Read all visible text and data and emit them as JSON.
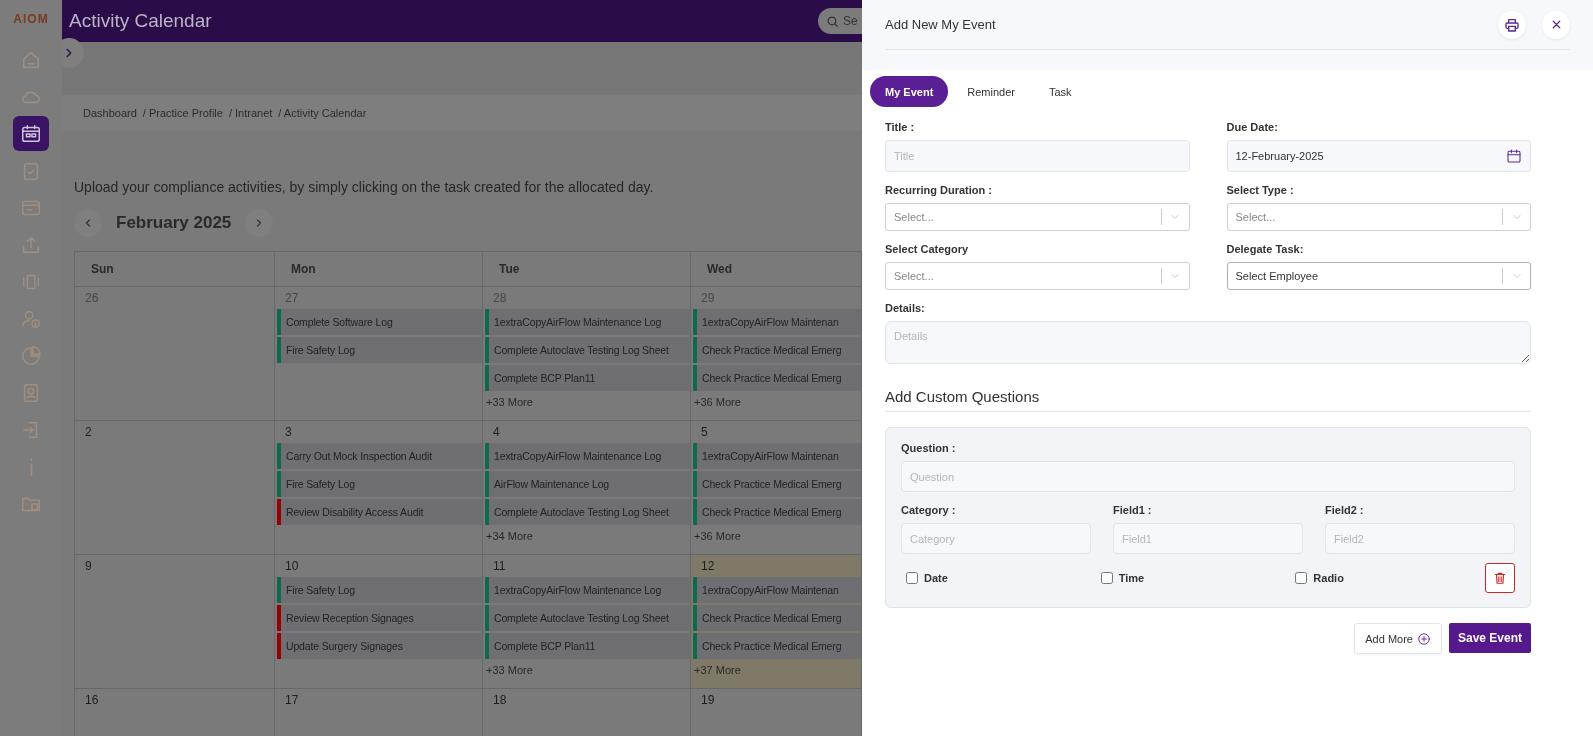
{
  "logo": "AIOM",
  "header": {
    "title": "Activity Calendar",
    "search_placeholder": "Se"
  },
  "sidebar": {
    "items": [
      {
        "selected": false
      },
      {
        "selected": false
      },
      {
        "selected": true
      },
      {
        "selected": false
      },
      {
        "selected": false
      },
      {
        "selected": false
      },
      {
        "selected": false
      },
      {
        "selected": false
      },
      {
        "selected": false
      },
      {
        "selected": false
      },
      {
        "selected": false
      },
      {
        "selected": false
      },
      {
        "selected": false
      }
    ]
  },
  "breadcrumb": [
    "Dashboard",
    "/ Practice Profile",
    "/ Intranet",
    "/ Activity Calendar"
  ],
  "intro": "Upload your compliance activities, by simply clicking on the task created for the allocated day.",
  "calendar": {
    "month": "February 2025",
    "weekdays": [
      "Sun",
      "Mon",
      "Tue",
      "Wed"
    ],
    "weeks": [
      [
        {
          "day": "26",
          "outside": true,
          "today": false
        },
        {
          "day": "27",
          "outside": true,
          "today": false,
          "events": [
            {
              "title": "Complete Software Log",
              "color": "#0b6b4c"
            },
            {
              "title": "Fire Safety Log",
              "color": "#0b6b4c"
            }
          ]
        },
        {
          "day": "28",
          "outside": true,
          "today": false,
          "events": [
            {
              "title": "1extraCopyAirFlow Maintenance Log",
              "color": "#0b6b4c"
            },
            {
              "title": "Complete Autoclave Testing Log Sheet",
              "color": "#0b6b4c"
            },
            {
              "title": "Complete BCP Plan11",
              "color": "#0b6b4c"
            }
          ],
          "more": "+33 More"
        },
        {
          "day": "29",
          "outside": true,
          "today": false,
          "events": [
            {
              "title": "1extraCopyAirFlow Maintenan",
              "color": "#0b6b4c"
            },
            {
              "title": "Check Practice Medical Emerg",
              "color": "#0b6b4c"
            },
            {
              "title": "Check Practice Medical Emerg",
              "color": "#0b6b4c"
            }
          ],
          "more": "+36 More"
        }
      ],
      [
        {
          "day": "2",
          "outside": false,
          "today": false
        },
        {
          "day": "3",
          "outside": false,
          "today": false,
          "events": [
            {
              "title": "Carry Out Mock Inspection Audit",
              "color": "#0b6b4c"
            },
            {
              "title": "Fire Safety Log",
              "color": "#0b6b4c"
            },
            {
              "title": "Review Disability Access Audit",
              "color": "#9b0000"
            }
          ]
        },
        {
          "day": "4",
          "outside": false,
          "today": false,
          "events": [
            {
              "title": "1extraCopyAirFlow Maintenance Log",
              "color": "#0b6b4c"
            },
            {
              "title": "AirFlow Maintenance Log",
              "color": "#0b6b4c"
            },
            {
              "title": "Complete Autoclave Testing Log Sheet",
              "color": "#0b6b4c"
            }
          ],
          "more": "+34 More"
        },
        {
          "day": "5",
          "outside": false,
          "today": false,
          "events": [
            {
              "title": "1extraCopyAirFlow Maintenan",
              "color": "#0b6b4c"
            },
            {
              "title": "Check Practice Medical Emerg",
              "color": "#0b6b4c"
            },
            {
              "title": "Check Practice Medical Emerg",
              "color": "#0b6b4c"
            }
          ],
          "more": "+36 More"
        }
      ],
      [
        {
          "day": "9",
          "outside": false,
          "today": false
        },
        {
          "day": "10",
          "outside": false,
          "today": false,
          "events": [
            {
              "title": "Fire Safety Log",
              "color": "#0b6b4c"
            },
            {
              "title": "Review Reception Signages",
              "color": "#9b0000"
            },
            {
              "title": "Update Surgery Signages",
              "color": "#9b0000"
            }
          ]
        },
        {
          "day": "11",
          "outside": false,
          "today": false,
          "events": [
            {
              "title": "1extraCopyAirFlow Maintenance Log",
              "color": "#0b6b4c"
            },
            {
              "title": "Complete Autoclave Testing Log Sheet",
              "color": "#0b6b4c"
            },
            {
              "title": "Complete BCP Plan11",
              "color": "#0b6b4c"
            }
          ],
          "more": "+33 More"
        },
        {
          "day": "12",
          "outside": false,
          "today": true,
          "events": [
            {
              "title": "1extraCopyAirFlow Maintenan",
              "color": "#0b6b4c"
            },
            {
              "title": "Check Practice Medical Emerg",
              "color": "#0b6b4c"
            },
            {
              "title": "Check Practice Medical Emerg",
              "color": "#0b6b4c"
            }
          ],
          "more": "+37 More"
        }
      ],
      [
        {
          "day": "16",
          "outside": false,
          "today": false
        },
        {
          "day": "17",
          "outside": false,
          "today": false
        },
        {
          "day": "18",
          "outside": false,
          "today": false
        },
        {
          "day": "19",
          "outside": false,
          "today": false
        }
      ]
    ]
  },
  "drawer": {
    "title": "Add New My Event",
    "tabs": [
      {
        "label": "My Event",
        "selected": true
      },
      {
        "label": "Reminder",
        "selected": false
      },
      {
        "label": "Task",
        "selected": false
      }
    ],
    "fields": [
      {
        "kind": "input",
        "label": "Title :",
        "placeholder": "Title"
      },
      {
        "kind": "date",
        "label": "Due Date:",
        "value": "12-February-2025"
      },
      {
        "kind": "select",
        "label": "Recurring Duration :",
        "placeholder": "Select..."
      },
      {
        "kind": "select",
        "label": "Select Type :",
        "placeholder": "Select..."
      },
      {
        "kind": "select",
        "label": "Select Category",
        "placeholder": "Select..."
      },
      {
        "kind": "select",
        "label": "Delegate Task:",
        "value": "Select Employee"
      },
      {
        "kind": "textarea",
        "label": "Details:",
        "placeholder": "Details"
      }
    ],
    "section_title": "Add Custom Questions",
    "question": {
      "label": "Question :",
      "placeholder": "Question",
      "fields": [
        {
          "label": "Category :",
          "placeholder": "Category"
        },
        {
          "label": "Field1 :",
          "placeholder": "Field1"
        },
        {
          "label": "Field2 :",
          "placeholder": "Field2"
        }
      ],
      "options": [
        {
          "label": "Date",
          "checked": false
        },
        {
          "label": "Time",
          "checked": false
        },
        {
          "label": "Radio",
          "checked": false
        }
      ]
    },
    "add_more": "Add More",
    "save": "Save Event"
  }
}
